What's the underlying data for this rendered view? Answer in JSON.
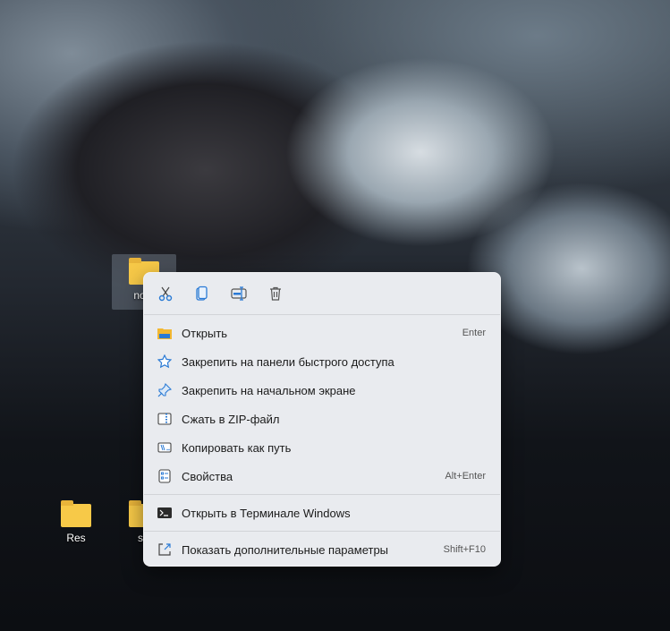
{
  "desktop": {
    "icons": [
      {
        "label": "note",
        "selected": true
      },
      {
        "label": "Res",
        "selected": false
      },
      {
        "label": "s",
        "selected": false
      }
    ]
  },
  "context_menu": {
    "toolbar": [
      {
        "name": "cut-icon",
        "title": "Cut"
      },
      {
        "name": "copy-icon",
        "title": "Copy"
      },
      {
        "name": "rename-icon",
        "title": "Rename"
      },
      {
        "name": "delete-icon",
        "title": "Delete"
      }
    ],
    "items": [
      {
        "label": "Открыть",
        "shortcut": "Enter",
        "icon": "folder-open-icon"
      },
      {
        "label": "Закрепить на панели быстрого доступа",
        "shortcut": "",
        "icon": "star-icon"
      },
      {
        "label": "Закрепить на начальном экране",
        "shortcut": "",
        "icon": "pin-icon"
      },
      {
        "label": "Сжать в ZIP-файл",
        "shortcut": "",
        "icon": "zip-icon"
      },
      {
        "label": "Копировать как путь",
        "shortcut": "",
        "icon": "copy-path-icon"
      },
      {
        "label": "Свойства",
        "shortcut": "Alt+Enter",
        "icon": "properties-icon"
      },
      {
        "label": "Открыть в Терминале Windows",
        "shortcut": "",
        "icon": "terminal-icon"
      },
      {
        "label": "Показать дополнительные параметры",
        "shortcut": "Shift+F10",
        "icon": "more-options-icon"
      }
    ]
  }
}
